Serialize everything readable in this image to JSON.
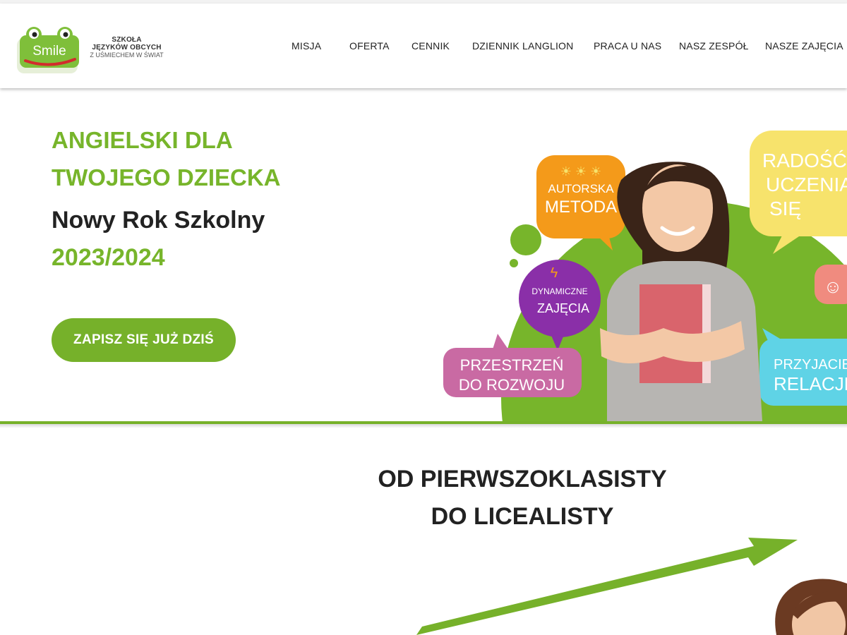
{
  "logo": {
    "badge_text": "Smile",
    "line1": "SZKOŁA",
    "line2": "JĘZYKÓW OBCYCH",
    "tagline": "Z UŚMIECHEM W ŚWIAT"
  },
  "nav": {
    "items": [
      "MISJA",
      "OFERTA",
      "CENNIK",
      "DZIENNIK LANGLION",
      "PRACA U NAS",
      "NASZ ZESPÓŁ",
      "NASZE ZAJĘCIA"
    ]
  },
  "hero": {
    "headline_line1": "ANGIELSKI DLA",
    "headline_line2": "TWOJEGO DZIECKA",
    "subtitle": "Nowy Rok Szkolny",
    "year": "2023/2024",
    "cta_label": "ZAPISZ SIĘ JUŻ DZIŚ",
    "bubbles": {
      "autorska_1": "AUTORSKA",
      "autorska_2": "METODA",
      "dynamiczne_1": "DYNAMICZNE",
      "dynamiczne_2": "ZAJĘCIA",
      "przestrzen_1": "PRZESTRZEŃ",
      "przestrzen_2": "DO ROZWOJU",
      "radosc_1": "RADOŚĆ",
      "radosc_2": "UCZENIA",
      "radosc_3": "SIĘ",
      "przyjaciel_1": "PRZYJACIEL",
      "przyjaciel_2": "RELACJE"
    }
  },
  "section": {
    "title_line1": "OD PIERWSZOKLASISTY",
    "title_line2": "DO LICEALISTY"
  },
  "colors": {
    "brand_green": "#76b12a",
    "orange": "#f49a1a",
    "purple": "#8a2fa8",
    "pink": "#c96aa3",
    "yellow": "#f7e36c",
    "cyan": "#5fd3e6"
  }
}
